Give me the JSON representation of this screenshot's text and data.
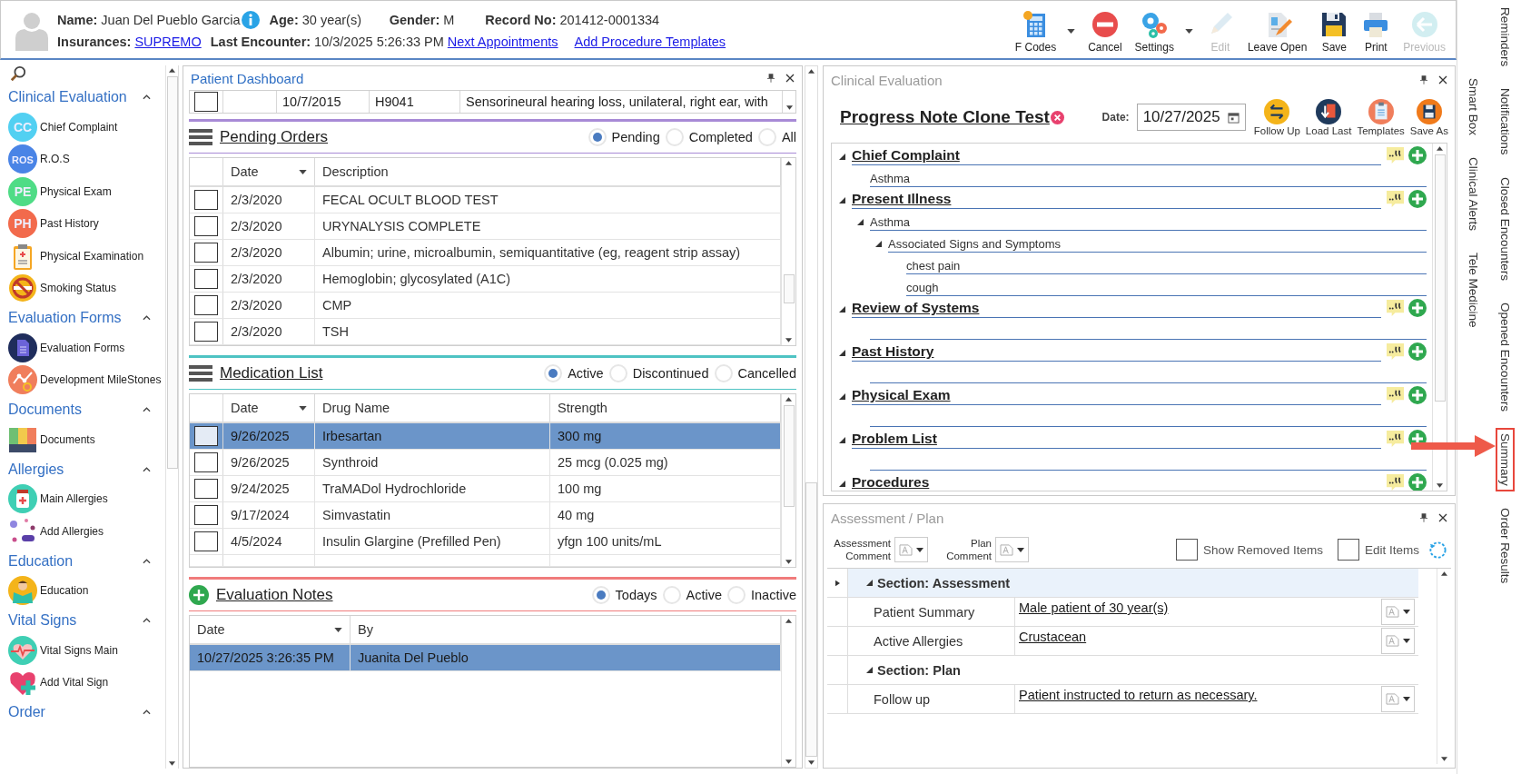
{
  "patient": {
    "name_label": "Name:",
    "name": "Juan Del Pueblo Garcia",
    "age_label": "Age:",
    "age": "30 year(s)",
    "gender_label": "Gender:",
    "gender": "M",
    "record_label": "Record No:",
    "record": "201412-0001334",
    "insurances_label": "Insurances:",
    "insurance": "SUPREMO",
    "last_encounter_label": "Last Encounter:",
    "last_encounter": "10/3/2025 5:26:33 PM",
    "links": [
      "Next Appointments",
      "Add Procedure Templates"
    ]
  },
  "toolbar": [
    {
      "label": "F Codes",
      "kind": "calculator",
      "disabled": false,
      "dropdown": true
    },
    {
      "label": "Cancel",
      "kind": "cancel",
      "disabled": false,
      "dropdown": false
    },
    {
      "label": "Settings",
      "kind": "gears",
      "disabled": false,
      "dropdown": true
    },
    {
      "label": "Edit",
      "kind": "pencil",
      "disabled": true,
      "dropdown": false
    },
    {
      "label": "Leave Open",
      "kind": "document",
      "disabled": false,
      "dropdown": false
    },
    {
      "label": "Save",
      "kind": "floppy",
      "disabled": false,
      "dropdown": false
    },
    {
      "label": "Print",
      "kind": "printer",
      "disabled": false,
      "dropdown": false
    },
    {
      "label": "Previous",
      "kind": "back",
      "disabled": true,
      "dropdown": false
    }
  ],
  "side_tabs": {
    "outer": [
      {
        "label": "Reminders",
        "highlighted": false
      },
      {
        "label": "Notifications",
        "highlighted": false
      },
      {
        "label": "Closed Encounters",
        "highlighted": false
      },
      {
        "label": "Opened Encounters",
        "highlighted": false
      },
      {
        "label": "Summary",
        "highlighted": true
      },
      {
        "label": "Order Results",
        "highlighted": false
      }
    ],
    "inner": [
      {
        "label": "Smart Box",
        "highlighted": false
      },
      {
        "label": "Clinical Alerts",
        "highlighted": false
      },
      {
        "label": "Tele Medicine",
        "highlighted": false
      }
    ]
  },
  "sidebar": {
    "sections": [
      {
        "title": "Clinical Evaluation",
        "expanded": true,
        "items": [
          {
            "label": "Chief Complaint",
            "kind": "badge",
            "badge": "CC",
            "color": "#52d0f2"
          },
          {
            "label": "R.O.S",
            "kind": "badge",
            "badge": "ROS",
            "color": "#4a84e6"
          },
          {
            "label": "Physical Exam",
            "kind": "badge",
            "badge": "PE",
            "color": "#4fdc86"
          },
          {
            "label": "Past History",
            "kind": "badge",
            "badge": "PH",
            "color": "#f26a4c"
          },
          {
            "label": "Physical Examination",
            "kind": "clipboard"
          },
          {
            "label": "Smoking Status",
            "kind": "nosmoking"
          }
        ]
      },
      {
        "title": "Evaluation Forms",
        "expanded": true,
        "items": [
          {
            "label": "Evaluation Forms",
            "kind": "form"
          },
          {
            "label": "Development MileStones",
            "kind": "chart"
          }
        ]
      },
      {
        "title": "Documents",
        "expanded": true,
        "items": [
          {
            "label": "Documents",
            "kind": "binders"
          }
        ]
      },
      {
        "title": "Allergies",
        "expanded": true,
        "items": [
          {
            "label": "Main Allergies",
            "kind": "bottle"
          },
          {
            "label": "Add Allergies",
            "kind": "pills"
          }
        ]
      },
      {
        "title": "Education",
        "expanded": true,
        "items": [
          {
            "label": "Education",
            "kind": "reader"
          }
        ]
      },
      {
        "title": "Vital Signs",
        "expanded": true,
        "items": [
          {
            "label": "Vital Signs Main",
            "kind": "heartbeat"
          },
          {
            "label": "Add Vital Sign",
            "kind": "heartplus"
          }
        ]
      },
      {
        "title": "Order",
        "expanded": true
      }
    ]
  },
  "dashboard": {
    "title": "Patient Dashboard",
    "diagnosis_row": {
      "date": "10/7/2015",
      "code": "H9041",
      "description": "Sensorineural hearing loss, unilateral, right ear, with",
      "checked": false
    },
    "pending_orders": {
      "title": "Pending Orders",
      "filters": [
        {
          "label": "Pending",
          "selected": true
        },
        {
          "label": "Completed",
          "selected": false
        },
        {
          "label": "All",
          "selected": false
        }
      ],
      "columns": [
        "Date",
        "Description"
      ],
      "rows": [
        {
          "date": "2/3/2020",
          "description": "FECAL OCULT BLOOD TEST",
          "checked": false
        },
        {
          "date": "2/3/2020",
          "description": "URYNALYSIS COMPLETE",
          "checked": false
        },
        {
          "date": "2/3/2020",
          "description": "Albumin; urine, microalbumin, semiquantitative (eg, reagent strip assay)",
          "checked": false
        },
        {
          "date": "2/3/2020",
          "description": "Hemoglobin; glycosylated (A1C)",
          "checked": false
        },
        {
          "date": "2/3/2020",
          "description": "CMP",
          "checked": false
        },
        {
          "date": "2/3/2020",
          "description": "TSH",
          "checked": false
        }
      ]
    },
    "medication_list": {
      "title": "Medication List",
      "filters": [
        {
          "label": "Active",
          "selected": true
        },
        {
          "label": "Discontinued",
          "selected": false
        },
        {
          "label": "Cancelled",
          "selected": false
        }
      ],
      "columns": [
        "Date",
        "Drug Name",
        "Strength"
      ],
      "rows": [
        {
          "date": "9/26/2025",
          "drug": "Irbesartan",
          "strength": "300 mg",
          "selected": true,
          "checked": false
        },
        {
          "date": "9/26/2025",
          "drug": "Synthroid",
          "strength": "25 mcg (0.025 mg)",
          "selected": false,
          "checked": false
        },
        {
          "date": "9/24/2025",
          "drug": "TraMADol Hydrochloride",
          "strength": "100 mg",
          "selected": false,
          "checked": false
        },
        {
          "date": "9/17/2024",
          "drug": "Simvastatin",
          "strength": "40 mg",
          "selected": false,
          "checked": false
        },
        {
          "date": "4/5/2024",
          "drug": "Insulin Glargine (Prefilled Pen)",
          "strength": "yfgn 100 units/mL",
          "selected": false,
          "checked": false
        }
      ]
    },
    "evaluation_notes": {
      "title": "Evaluation Notes",
      "filters": [
        {
          "label": "Todays",
          "selected": true
        },
        {
          "label": "Active",
          "selected": false
        },
        {
          "label": "Inactive",
          "selected": false
        }
      ],
      "columns": [
        "Date",
        "By"
      ],
      "rows": [
        {
          "date": "10/27/2025 3:26:35 PM",
          "by": "Juanita Del Pueblo",
          "selected": true
        }
      ]
    }
  },
  "clinical_evaluation": {
    "title": "Clinical Evaluation",
    "note_title": "Progress Note Clone Test",
    "date_label": "Date:",
    "date": "10/27/2025",
    "actions": [
      {
        "label": "Follow Up",
        "kind": "swap"
      },
      {
        "label": "Load Last",
        "kind": "load"
      },
      {
        "label": "Templates",
        "kind": "clipboard"
      },
      {
        "label": "Save As",
        "kind": "floppy"
      }
    ],
    "sections": [
      {
        "title": "Chief Complaint",
        "expanded": true,
        "children": [
          {
            "label": "Asthma"
          }
        ]
      },
      {
        "title": "Present Illness",
        "expanded": true,
        "children": [
          {
            "label": "Asthma",
            "expanded": true,
            "children": [
              {
                "label": "Associated Signs and Symptoms",
                "expanded": true,
                "children": [
                  {
                    "label": "chest pain"
                  },
                  {
                    "label": "cough"
                  }
                ]
              }
            ]
          }
        ]
      },
      {
        "title": "Review of Systems",
        "expanded": true
      },
      {
        "title": "Past History",
        "expanded": true
      },
      {
        "title": "Physical Exam",
        "expanded": true
      },
      {
        "title": "Problem List",
        "expanded": true
      },
      {
        "title": "Procedures",
        "expanded": true
      }
    ]
  },
  "assessment_plan": {
    "title": "Assessment / Plan",
    "comments": [
      "Assessment Comment",
      "Plan Comment"
    ],
    "options": [
      {
        "label": "Show Removed Items",
        "checked": false
      },
      {
        "label": "Edit Items",
        "checked": false
      }
    ],
    "sections": [
      {
        "title": "Section: Assessment",
        "selected": true,
        "expanded": true,
        "rows": [
          {
            "label": "Patient Summary",
            "value": "Male patient of 30 year(s)"
          },
          {
            "label": "Active Allergies",
            "value": "Crustacean"
          }
        ]
      },
      {
        "title": "Section: Plan",
        "selected": false,
        "expanded": true,
        "rows": [
          {
            "label": "Follow up",
            "value": "Patient instructed to return as necessary."
          }
        ]
      }
    ]
  }
}
